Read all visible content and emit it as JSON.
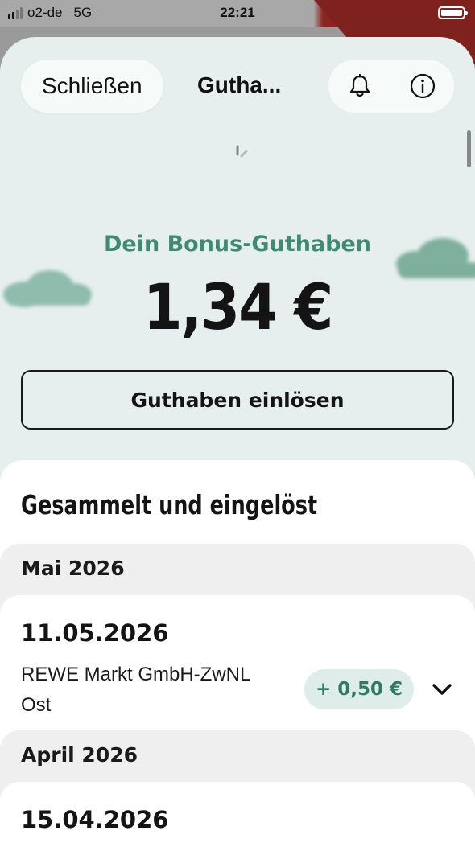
{
  "status_bar": {
    "carrier": "o2-de",
    "network": "5G",
    "time": "22:21"
  },
  "header": {
    "close_label": "Schließen",
    "title": "Gutha...",
    "icons": [
      "bell-icon",
      "info-icon"
    ]
  },
  "bonus": {
    "label": "Dein Bonus-Guthaben",
    "amount": "1,34 €",
    "redeem_label": "Guthaben einlösen"
  },
  "history": {
    "title": "Gesammelt und eingelöst",
    "months": [
      {
        "label": "Mai 2026",
        "entries": [
          {
            "date": "11.05.2026",
            "merchant": "REWE Markt GmbH-ZwNL Ost",
            "amount": "+ 0,50 €"
          }
        ]
      },
      {
        "label": "April 2026",
        "entries": [
          {
            "date": "15.04.2026"
          }
        ]
      }
    ]
  },
  "colors": {
    "accent_green": "#3f8a72",
    "sheet_background": "#e6efed",
    "badge_background": "#deede9",
    "status_red": "#7f211d"
  }
}
